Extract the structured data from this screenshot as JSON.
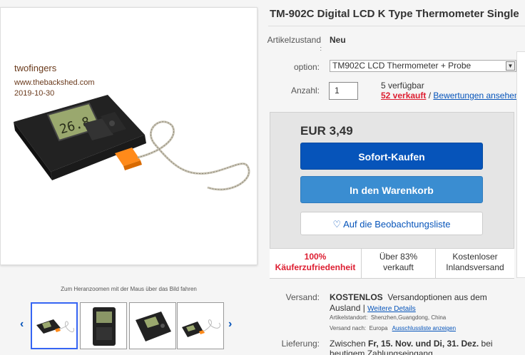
{
  "product": {
    "title": "TM-902C Digital LCD K Type Thermometer Single",
    "watermark_user": "twofingers",
    "watermark_site": "www.thebackshed.com",
    "watermark_date": "2019-10-30"
  },
  "image_panel": {
    "zoom_hint": "Zum Heranzoomen mit der Maus über das Bild fahren",
    "prev_icon": "chevron-left-icon",
    "next_icon": "chevron-right-icon",
    "thumb_count": 4,
    "lcd_display": "26.8"
  },
  "details": {
    "condition_label": "Artikelzustand",
    "condition_colon": ":",
    "condition_value": "Neu",
    "option_label": "option:",
    "option_selected": "TM902C LCD Thermometer + Probe",
    "qty_label": "Anzahl:",
    "qty_value": "1",
    "available": "5 verfügbar",
    "sold": "52 verkauft",
    "slash": "/",
    "reviews_link": "Bewertungen ansehen"
  },
  "buy": {
    "price": "EUR 3,49",
    "buy_now": "Sofort-Kaufen",
    "add_to_cart": "In den Warenkorb",
    "watch_icon": "heart-icon",
    "watch": "Auf die Beobachtungsliste"
  },
  "stats": {
    "satisfaction_pct": "100%",
    "satisfaction_label": "Käuferzufriedenheit",
    "sold_pct": "Über 83%",
    "sold_label": "verkauft",
    "shipping_line1": "Kostenloser",
    "shipping_line2": "Inlandsversand"
  },
  "shipping": {
    "label": "Versand:",
    "value": "KOSTENLOS",
    "options_text": "Versandoptionen aus dem",
    "options_text2": "Ausland |",
    "details_link": "Weitere Details",
    "location_label": "Artikelstandort:",
    "location": "Shenzhen,Guangdong, China",
    "ships_to_label": "Versand nach:",
    "ships_to": "Europa",
    "exclusions_link": "Ausschlussliste anzeigen"
  },
  "delivery": {
    "label": "Lieferung:",
    "text_pre": "Zwischen ",
    "dates": "Fr, 15. Nov. und Di, 31. Dez.",
    "text_post": " bei",
    "line2": "heutigem Zahlungseingang"
  },
  "colors": {
    "primary_blue": "#0654ba",
    "cart_blue": "#3a8dd1",
    "red": "#dd1e31"
  }
}
